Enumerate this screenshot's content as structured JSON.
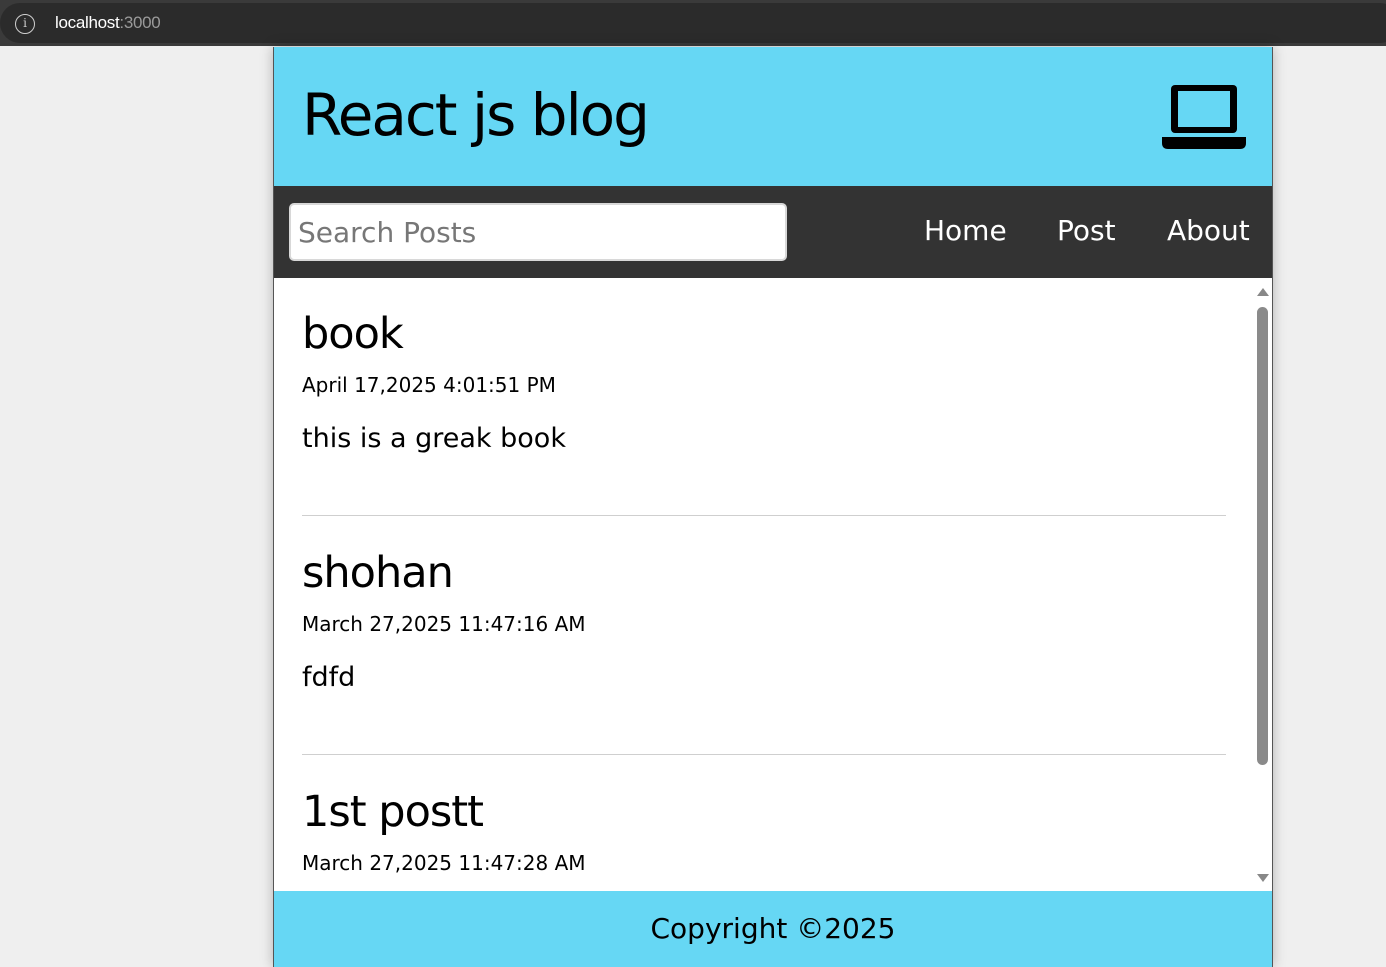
{
  "browser": {
    "url_host": "localhost",
    "url_port": ":3000"
  },
  "header": {
    "title": "React js blog",
    "icon": "laptop-icon"
  },
  "nav": {
    "search_placeholder": "Search Posts",
    "search_value": "",
    "links": [
      {
        "label": "Home"
      },
      {
        "label": "Post"
      },
      {
        "label": "About"
      }
    ]
  },
  "posts": [
    {
      "title": "book",
      "date": "April 17,2025 4:01:51 PM",
      "body": "this is a greak book"
    },
    {
      "title": "shohan",
      "date": "March 27,2025 11:47:16 AM",
      "body": "fdfd"
    },
    {
      "title": "1st postt",
      "date": "March 27,2025 11:47:28 AM",
      "body": ""
    }
  ],
  "footer": {
    "copyright": "Copyright ©2025"
  },
  "colors": {
    "accent": "#66d7f4",
    "nav_bg": "#333333"
  }
}
